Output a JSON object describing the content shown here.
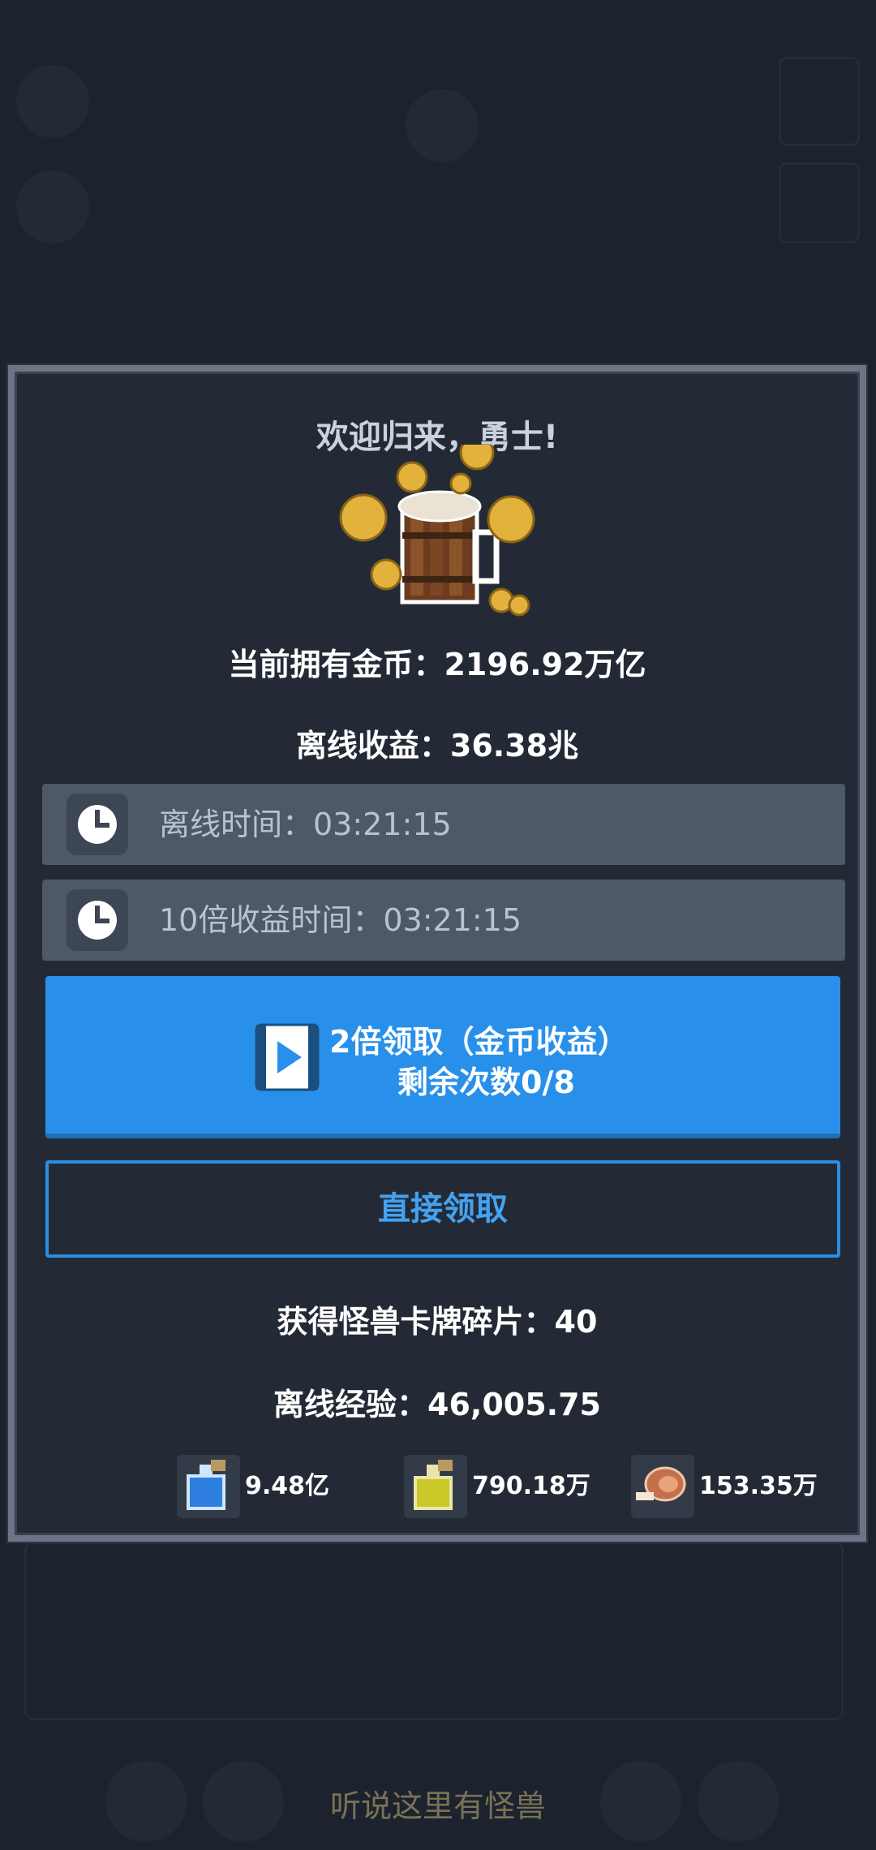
{
  "dialog": {
    "title": "欢迎归来，勇士!",
    "current_gold": "当前拥有金币：2196.92万亿",
    "offline_income": "离线收益：36.38兆",
    "offline_time": "离线时间：03:21:15",
    "ten_x_time": "10倍收益时间：03:21:15",
    "double_claim_line1": "2倍领取（金币收益）",
    "double_claim_line2": "剩余次数0/8",
    "direct_claim": "直接领取",
    "monster_card_shards": "获得怪兽卡牌碎片：40",
    "offline_exp": "离线经验：46,005.75",
    "resources": [
      {
        "icon": "blue-potion-icon",
        "value": "9.48亿"
      },
      {
        "icon": "yellow-potion-icon",
        "value": "790.18万"
      },
      {
        "icon": "meat-icon",
        "value": "153.35万"
      }
    ]
  },
  "footer": {
    "text": "听说这里有怪兽"
  },
  "colors": {
    "primary_button": "#2890ea",
    "outline_button": "#2b8ee3",
    "dialog_bg": "#242a35"
  }
}
